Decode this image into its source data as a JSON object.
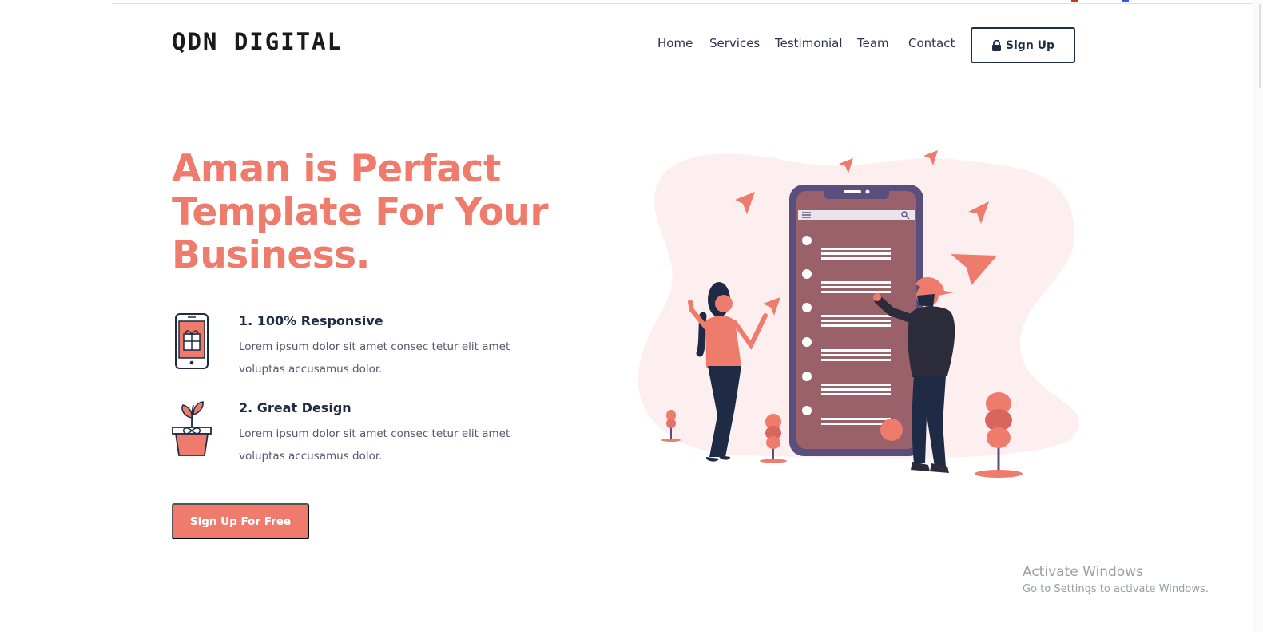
{
  "header": {
    "logo_text": "QDN DIGITAL",
    "nav": [
      {
        "label": "Home"
      },
      {
        "label": "Services"
      },
      {
        "label": "Testimonial"
      },
      {
        "label": "Team"
      },
      {
        "label": "Contact"
      }
    ],
    "signup_label": "Sign Up",
    "signup_icon": "lock-icon"
  },
  "hero": {
    "title_lines": [
      "Aman is Perfact",
      "Template For Your",
      "Business."
    ],
    "features": [
      {
        "title": "1. 100% Responsive",
        "description": "Lorem ipsum dolor sit amet consec tetur elit amet voluptas accusamus dolor.",
        "icon": "smartphone-icon"
      },
      {
        "title": "2. Great Design",
        "description": "Lorem ipsum dolor sit amet consec tetur elit amet voluptas accusamus dolor.",
        "icon": "plant-pot-icon"
      }
    ],
    "cta_label": "Sign Up For Free",
    "illustration": "people-with-phone-list-illustration"
  },
  "watermark": {
    "title": "Activate Windows",
    "subtitle": "Go to Settings to activate Windows."
  },
  "colors": {
    "accent": "#ee7b6b",
    "dark": "#1f2a44",
    "blob": "#fdeff0"
  }
}
